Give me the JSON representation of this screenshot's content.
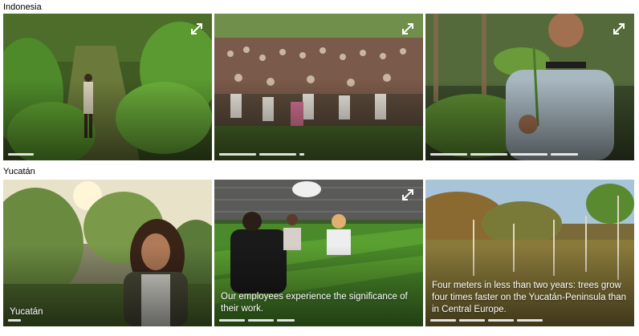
{
  "sections": {
    "indonesia": {
      "label": "Indonesia"
    },
    "yucatan": {
      "label": "Yucatán"
    }
  },
  "tiles": [
    {
      "id": "indo-1",
      "caption": "",
      "segments": 1,
      "active": 0,
      "expand": true
    },
    {
      "id": "indo-2",
      "caption": "",
      "segments": 3,
      "active": 1,
      "expand": true
    },
    {
      "id": "indo-3",
      "caption": "",
      "segments": 4,
      "active": 3,
      "expand": true
    },
    {
      "id": "yuc-1",
      "caption": "Yucatán",
      "segments": 1,
      "active": 0,
      "expand": false
    },
    {
      "id": "yuc-2",
      "caption": "Our employees experience the significance of their work.",
      "segments": 3,
      "active": 0,
      "expand": true
    },
    {
      "id": "yuc-3",
      "caption": "Four meters in less than two years: trees grow four times faster on the Yucatán-Peninsula than in Central Europe.",
      "segments": 4,
      "active": 0,
      "expand": false
    }
  ],
  "icons": {
    "expand": "expand-icon"
  }
}
